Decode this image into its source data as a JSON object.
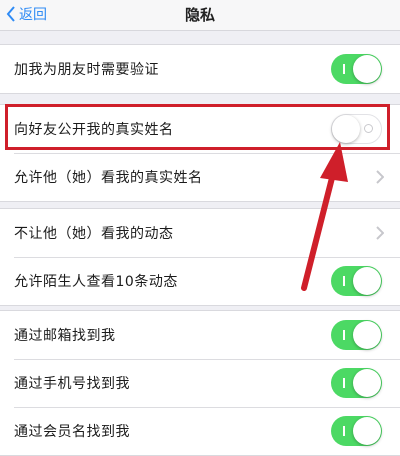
{
  "nav": {
    "back_label": "返回",
    "title": "隐私"
  },
  "groups": [
    {
      "rows": [
        {
          "label": "加我为朋友时需要验证",
          "control": "toggle",
          "state": "on"
        }
      ]
    },
    {
      "rows": [
        {
          "label": "向好友公开我的真实姓名",
          "control": "toggle",
          "state": "off"
        },
        {
          "label": "允许他（她）看我的真实姓名",
          "control": "chevron"
        }
      ]
    },
    {
      "rows": [
        {
          "label": "不让他（她）看我的动态",
          "control": "chevron"
        },
        {
          "label": "允许陌生人查看10条动态",
          "control": "toggle",
          "state": "on"
        }
      ]
    },
    {
      "rows": [
        {
          "label": "通过邮箱找到我",
          "control": "toggle",
          "state": "on"
        },
        {
          "label": "通过手机号找到我",
          "control": "toggle",
          "state": "on"
        },
        {
          "label": "通过会员名找到我",
          "control": "toggle",
          "state": "on"
        }
      ]
    }
  ],
  "colors": {
    "toggle_on": "#4cd964",
    "accent_blue": "#2f8bf5",
    "annotation_red": "#cf1f2a",
    "background": "#efeff4"
  },
  "icons": [
    "chevron-left-icon",
    "chevron-right-icon",
    "arrow-annotation"
  ]
}
